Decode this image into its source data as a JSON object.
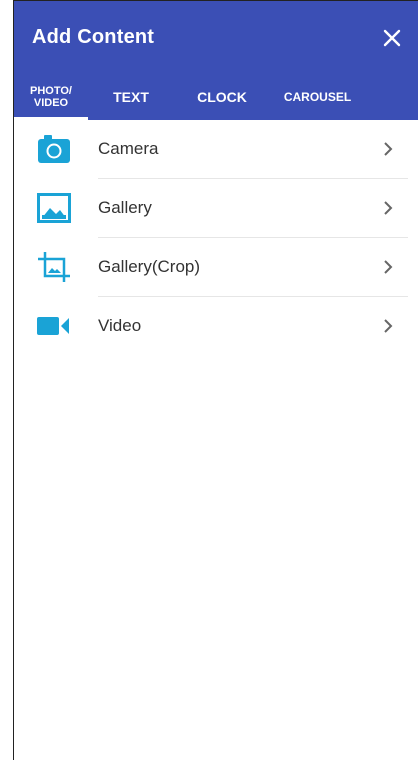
{
  "appbar": {
    "title": "Add Content",
    "close_icon": "close-icon",
    "color": "#3b4fb5"
  },
  "tabs": [
    {
      "line1": "PHOTO/",
      "line2": "VIDEO",
      "active": true
    },
    {
      "label": "TEXT",
      "active": false
    },
    {
      "label": "CLOCK",
      "active": false
    },
    {
      "label": "CAROUSEL",
      "active": false
    }
  ],
  "items": [
    {
      "label": "Camera",
      "icon": "camera-icon"
    },
    {
      "label": "Gallery",
      "icon": "image-icon"
    },
    {
      "label": "Gallery(Crop)",
      "icon": "crop-icon"
    },
    {
      "label": "Video",
      "icon": "video-camera-icon"
    }
  ],
  "colors": {
    "accent": "#1aa3d6",
    "chevron": "#666666"
  }
}
